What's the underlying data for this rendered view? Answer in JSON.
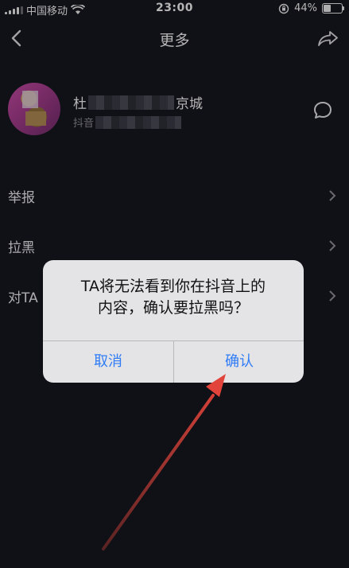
{
  "status_bar": {
    "carrier": "中国移动",
    "time": "23:00",
    "battery": "44%",
    "battery_level": 0.44
  },
  "nav": {
    "title": "更多"
  },
  "profile": {
    "name_start": "杜",
    "name_end": "京城",
    "sub_start": "抖音"
  },
  "menu": [
    {
      "label": "举报"
    },
    {
      "label": "拉黑"
    },
    {
      "label": "对TA"
    }
  ],
  "dialog": {
    "message_line1": "TA将无法看到你在抖音上的",
    "message_line2": "内容，确认要拉黑吗？",
    "cancel_label": "取消",
    "confirm_label": "确认"
  },
  "colors": {
    "background": "#16171e",
    "accent": "#2f7cf6",
    "annotation_arrow": "#e2443b"
  },
  "icons": [
    "back-arrow-icon",
    "share-icon",
    "message-icon",
    "chevron-right-icon",
    "wifi-icon",
    "orientation-lock-icon",
    "battery-icon"
  ]
}
